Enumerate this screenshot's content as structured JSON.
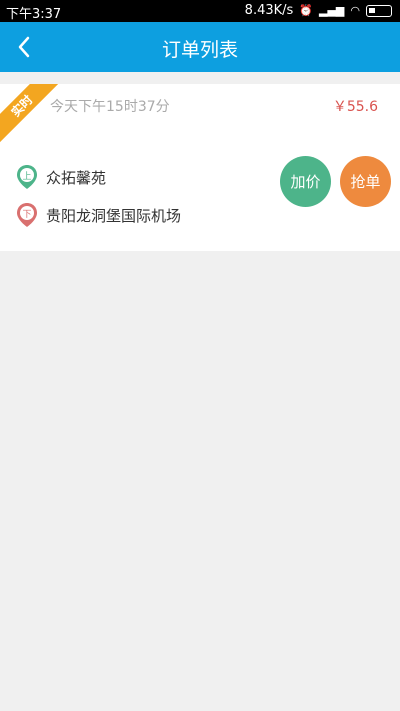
{
  "statusbar": {
    "time": "下午3:37",
    "net_speed": "8.43K/s"
  },
  "navbar": {
    "title": "订单列表"
  },
  "order": {
    "badge": "实时",
    "time": "今天下午15时37分",
    "price": "￥55.6",
    "start_marker": "上",
    "start_location": "众拓馨苑",
    "end_marker": "下",
    "end_location": "贵阳龙洞堡国际机场",
    "add_price_label": "加价",
    "grab_order_label": "抢单"
  },
  "colors": {
    "nav_bg": "#0d9fe0",
    "ribbon": "#f3a620",
    "price": "#d9534f",
    "start_pin": "#4db48a",
    "end_pin": "#d9706f",
    "add_btn": "#4db48a",
    "grab_btn": "#ee8a3e"
  }
}
